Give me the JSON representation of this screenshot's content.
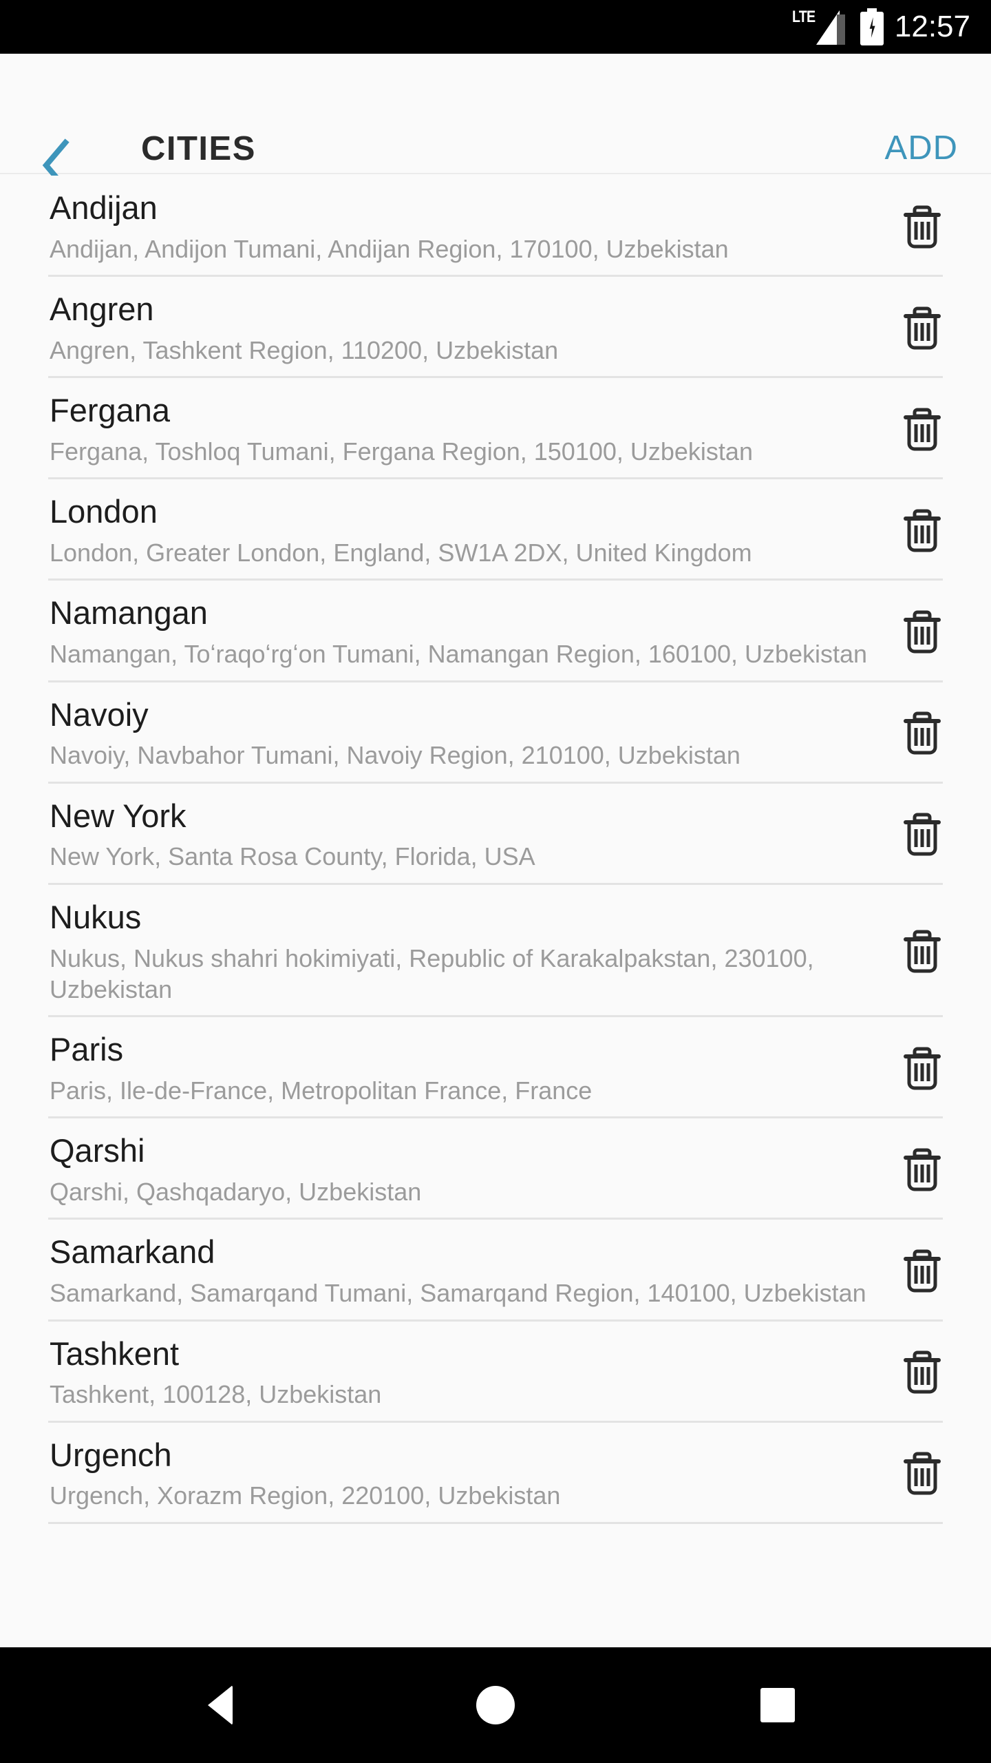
{
  "status_bar": {
    "network_label": "LTE",
    "signal_icon": "signal-bars-icon",
    "battery_icon": "battery-charging-icon",
    "time": "12:57"
  },
  "app_bar": {
    "back_icon": "chevron-left-icon",
    "title": "CITIES",
    "add_label": "ADD",
    "accent_color": "#3e95bb",
    "title_color": "#2b2b2b"
  },
  "list": {
    "delete_icon": "trash-icon",
    "items": [
      {
        "name": "Andijan",
        "address": "Andijan, Andijon Tumani, Andijan Region, 170100, Uzbekistan"
      },
      {
        "name": "Angren",
        "address": "Angren, Tashkent Region, 110200, Uzbekistan"
      },
      {
        "name": "Fergana",
        "address": "Fergana, Toshloq Tumani, Fergana Region, 150100, Uzbekistan"
      },
      {
        "name": "London",
        "address": "London, Greater London, England, SW1A 2DX, United Kingdom"
      },
      {
        "name": "Namangan",
        "address": "Namangan, Toʻraqoʻrgʻon Tumani, Namangan Region, 160100, Uzbekistan"
      },
      {
        "name": "Navoiy",
        "address": "Navoiy, Navbahor Tumani, Navoiy Region, 210100, Uzbekistan"
      },
      {
        "name": "New York",
        "address": "New York, Santa Rosa County, Florida, USA"
      },
      {
        "name": "Nukus",
        "address": "Nukus, Nukus shahri hokimiyati, Republic of Karakalpakstan, 230100, Uzbekistan"
      },
      {
        "name": "Paris",
        "address": "Paris, Ile-de-France, Metropolitan France, France"
      },
      {
        "name": "Qarshi",
        "address": "Qarshi, Qashqadaryo, Uzbekistan"
      },
      {
        "name": "Samarkand",
        "address": "Samarkand, Samarqand Tumani, Samarqand Region, 140100, Uzbekistan"
      },
      {
        "name": "Tashkent",
        "address": "Tashkent, 100128, Uzbekistan"
      },
      {
        "name": "Urgench",
        "address": "Urgench, Xorazm Region, 220100, Uzbekistan"
      }
    ]
  },
  "navigation_bar": {
    "back_icon": "triangle-back-icon",
    "home_icon": "circle-home-icon",
    "recents_icon": "square-recents-icon"
  }
}
